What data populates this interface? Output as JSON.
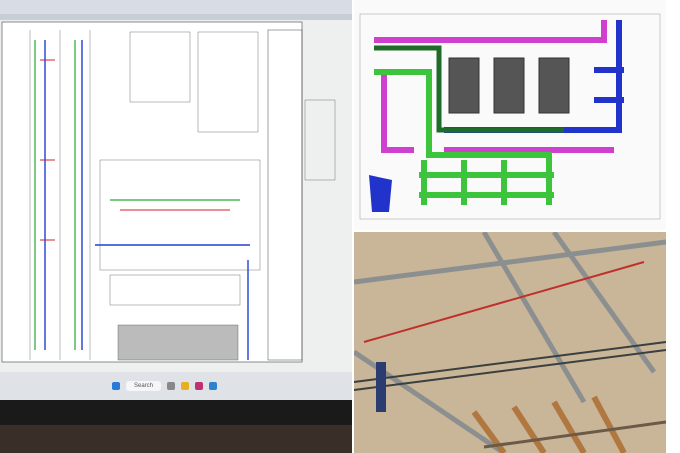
{
  "taskbar": {
    "search_label": "Search"
  },
  "colors": {
    "pipe_magenta": "#d040d0",
    "pipe_green": "#3cc43c",
    "pipe_blue": "#2233cc",
    "pipe_darkgreen": "#1e6b2a",
    "ceiling_wood": "#b9a07f"
  }
}
